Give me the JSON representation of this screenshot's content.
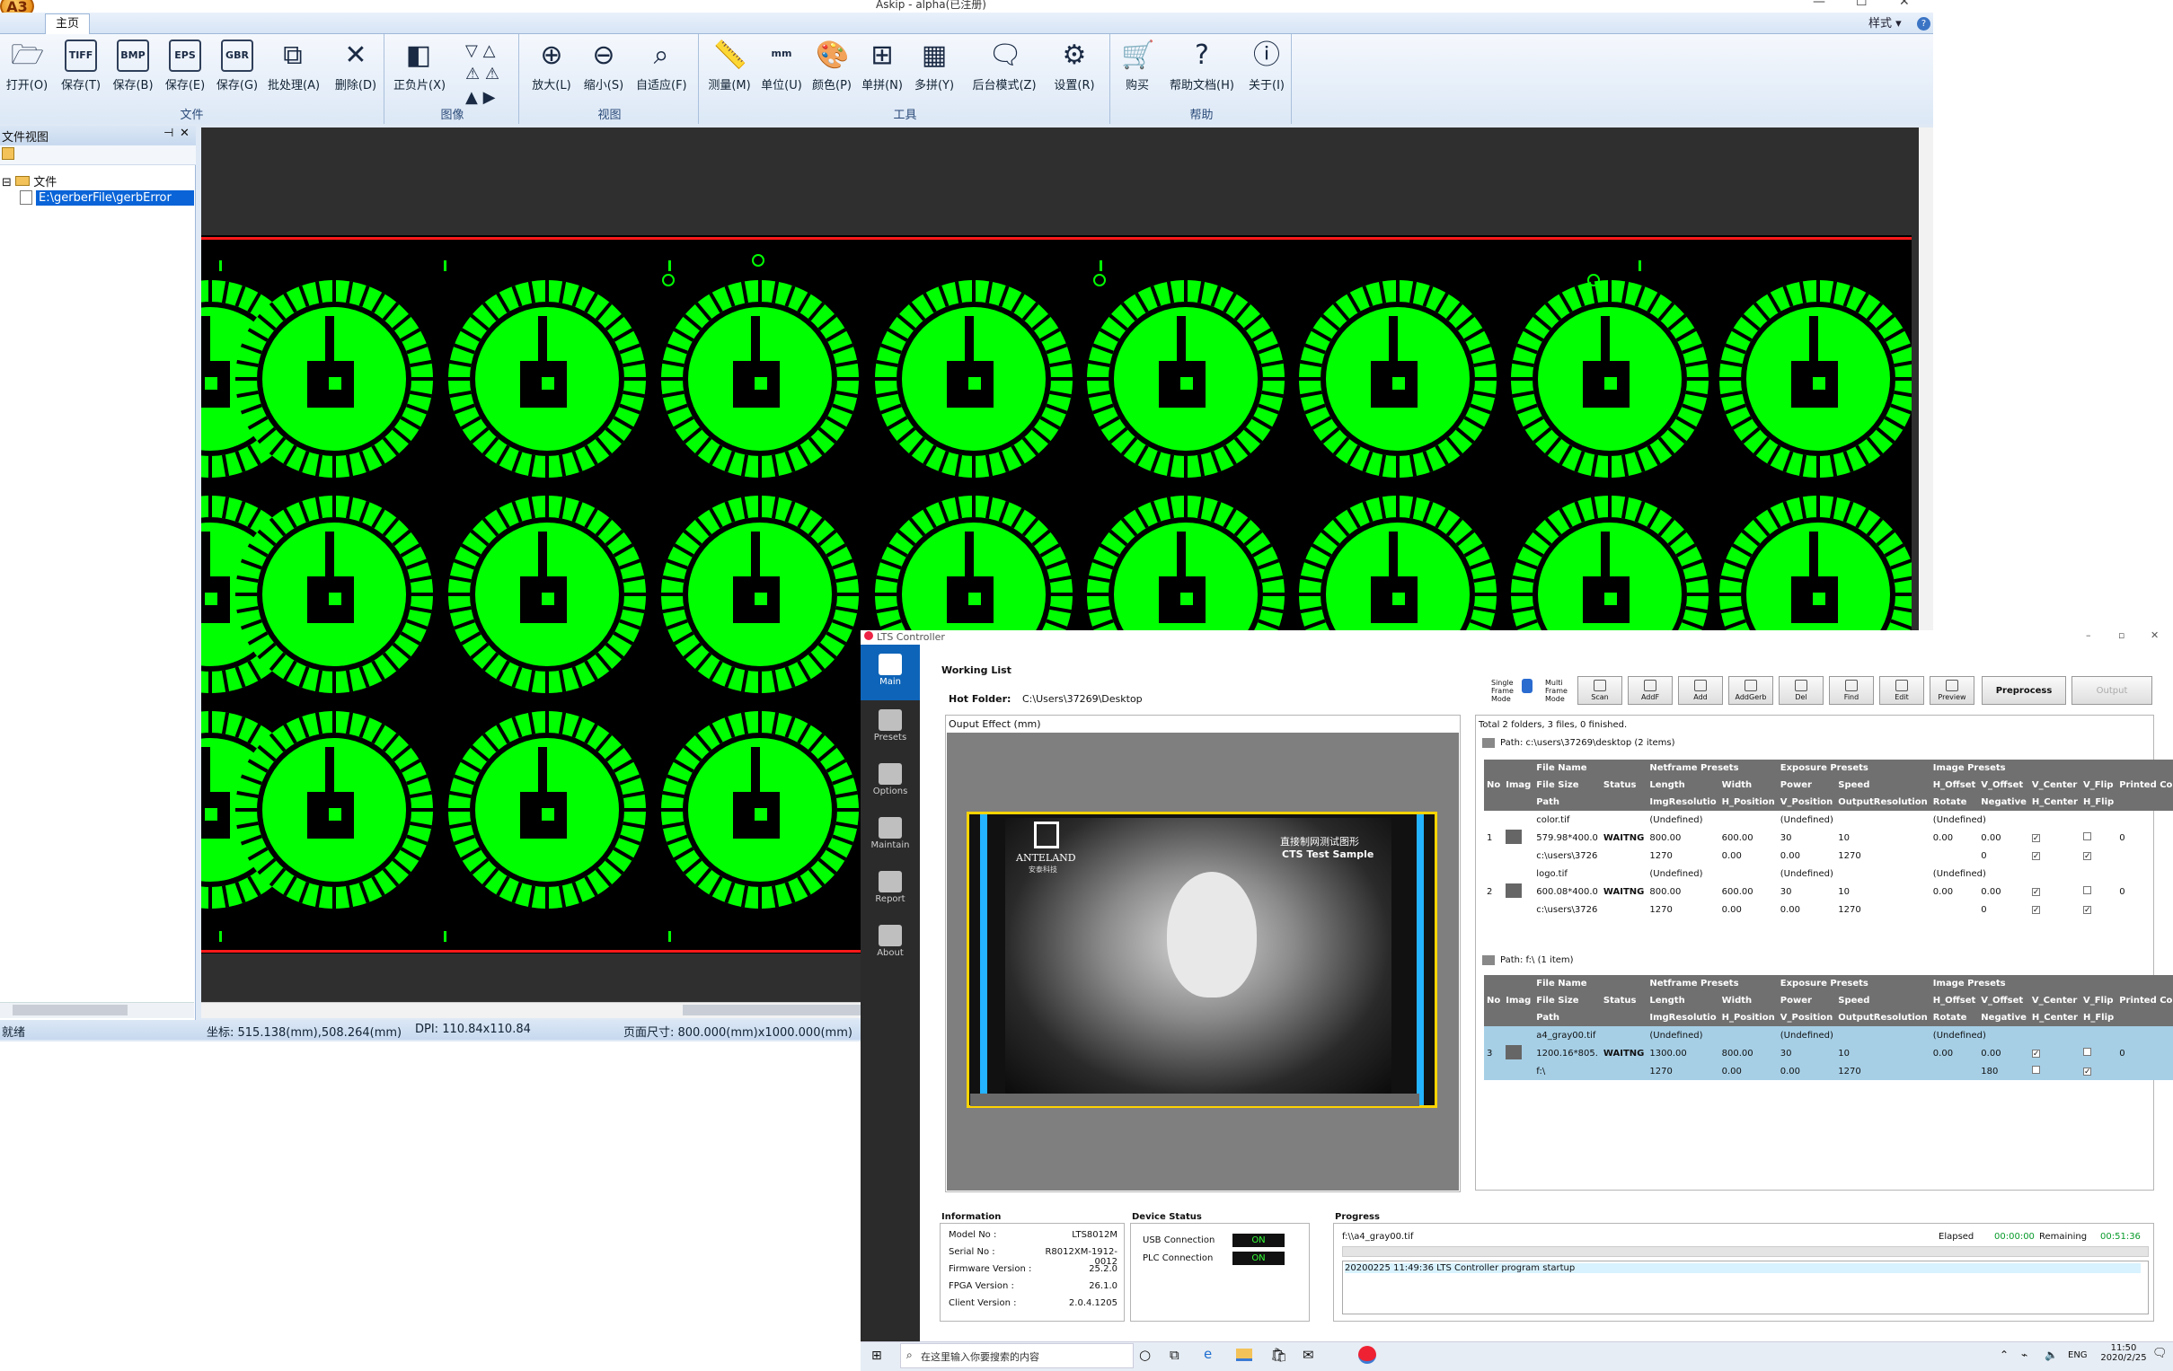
{
  "askip": {
    "window_title": "Askip - alpha(已注册)",
    "app_logo": "A3",
    "tab_home": "主页",
    "style_menu": "样式 ▾",
    "ribbon": {
      "groups": [
        {
          "label": "文件",
          "buttons": [
            {
              "label": "打开(O)",
              "icon": "folder-open-icon"
            },
            {
              "label": "保存(T)",
              "icon": "TIFF"
            },
            {
              "label": "保存(B)",
              "icon": "BMP"
            },
            {
              "label": "保存(E)",
              "icon": "EPS"
            },
            {
              "label": "保存(G)",
              "icon": "GBR"
            },
            {
              "label": "批处理(A)",
              "icon": "batch-icon"
            },
            {
              "label": "删除(D)",
              "icon": "delete-icon"
            }
          ]
        },
        {
          "label": "图像",
          "buttons": [
            {
              "label": "正负片(X)",
              "icon": "negative-icon"
            }
          ]
        },
        {
          "label": "视图",
          "buttons": [
            {
              "label": "放大(L)",
              "icon": "zoom-in-icon"
            },
            {
              "label": "缩小(S)",
              "icon": "zoom-out-icon"
            },
            {
              "label": "自适应(F)",
              "icon": "zoom-fit-icon"
            }
          ]
        },
        {
          "label": "工具",
          "buttons": [
            {
              "label": "测量(M)",
              "icon": "ruler-icon"
            },
            {
              "label": "单位(U)",
              "icon": "mm"
            },
            {
              "label": "颜色(P)",
              "icon": "palette-icon"
            },
            {
              "label": "单拼(N)",
              "icon": "grid-icon"
            },
            {
              "label": "多拼(Y)",
              "icon": "multi-grid-icon"
            },
            {
              "label": "后台模式(Z)",
              "icon": "chat-icon"
            },
            {
              "label": "设置(R)",
              "icon": "gear-icon"
            }
          ]
        },
        {
          "label": "帮助",
          "buttons": [
            {
              "label": "购买",
              "icon": "cart-icon"
            },
            {
              "label": "帮助文档(H)",
              "icon": "help-icon"
            },
            {
              "label": "关于(I)",
              "icon": "info-icon"
            }
          ]
        }
      ]
    },
    "file_view": {
      "title": "文件视图",
      "root": "文件",
      "child": "E:\\gerberFile\\gerbError"
    },
    "status": {
      "ready": "就绪",
      "coords": "坐标: 515.138(mm),508.264(mm)",
      "dpi": "DPI: 110.84x110.84",
      "page_size": "页面尺寸: 800.000(mm)x1000.000(mm)"
    },
    "colors": {
      "trace": "#00ff00",
      "frame": "#ff1a1a",
      "background": "#000000"
    }
  },
  "lts": {
    "window_title": "LTS Controller",
    "nav": [
      {
        "label": "Main",
        "icon": "home-icon"
      },
      {
        "label": "Presets",
        "icon": "presets-icon"
      },
      {
        "label": "Options",
        "icon": "options-icon"
      },
      {
        "label": "Maintain",
        "icon": "maintain-icon"
      },
      {
        "label": "Report",
        "icon": "report-icon"
      },
      {
        "label": "About",
        "icon": "about-icon"
      }
    ],
    "working_list": "Working List",
    "hot_folder_label": "Hot Folder:",
    "hot_folder_value": "C:\\Users\\37269\\Desktop",
    "single_frame": "Single Frame Mode",
    "multi_frame": "Multi Frame Mode",
    "toolbar": [
      "Scan",
      "AddF",
      "Add",
      "AddGerb",
      "Del",
      "Find",
      "Edit",
      "Preview"
    ],
    "preprocess": "Preprocess",
    "output": "Output",
    "output_effect": "Ouput Effect   (mm)",
    "preview": {
      "brand": "ANTELAND",
      "brand_cn": "安泰科技",
      "title_cn": "直接制网测试图形",
      "title_en": "CTS Test Sample"
    },
    "summary": "Total 2 folders, 3 files, 0 finished.",
    "folders": [
      {
        "path": "Path: c:\\users\\37269\\desktop (2 items)",
        "rows": [
          {
            "no": "1",
            "a": [
              "color.tif",
              "579.98*400.0",
              "c:\\users\\3726"
            ],
            "status": "WAITNG",
            "b": [
              "(Undefined)",
              "800.00",
              "600.00",
              "0.00",
              "0.00"
            ],
            "c": [
              "(Undefined)",
              "30",
              "10",
              "1270"
            ],
            "d": [
              "(Undefined)",
              "0.00",
              "0.00",
              "0"
            ],
            "printed": "0"
          },
          {
            "no": "2",
            "a": [
              "logo.tif",
              "600.08*400.0",
              "c:\\users\\3726"
            ],
            "status": "WAITNG",
            "b": [
              "(Undefined)",
              "800.00",
              "600.00",
              "0.00",
              "0.00"
            ],
            "c": [
              "(Undefined)",
              "30",
              "10",
              "1270"
            ],
            "d": [
              "(Undefined)",
              "0.00",
              "0.00",
              "0"
            ],
            "printed": "0"
          }
        ]
      },
      {
        "path": "Path: f:\\ (1 item)",
        "rows": [
          {
            "no": "3",
            "a": [
              "a4_gray00.tif",
              "1200.16*805.",
              "f:\\"
            ],
            "status": "WAITNG",
            "b": [
              "(Undefined)",
              "1300.00",
              "800.00",
              "0.00",
              "0.00"
            ],
            "c": [
              "(Undefined)",
              "30",
              "10",
              "1270"
            ],
            "d": [
              "(Undefined)",
              "0.00",
              "0.00",
              "180"
            ],
            "printed": "0"
          }
        ]
      }
    ],
    "headers": {
      "r1": [
        "No",
        "Imag",
        "File Name",
        "Status",
        "Netframe Presets",
        "",
        "Exposure Presets",
        "",
        "Image Presets",
        "",
        "",
        "",
        "Printed Co"
      ],
      "r2": [
        "File Size",
        "Length",
        "Width",
        "Power",
        "Speed",
        "H_Offset",
        "V_Offset",
        "V_Center",
        "V_Flip"
      ],
      "r3": [
        "Path",
        "ImgResolutio",
        "H_Position",
        "V_Position",
        "OutputResolution",
        "Rotate",
        "Negative",
        "H_Center",
        "H_Flip"
      ]
    },
    "info": {
      "title": "Information",
      "rows": [
        [
          "Model No :",
          "LTS8012M"
        ],
        [
          "Serial No :",
          "R8012XM-1912-0012"
        ],
        [
          "Firmware Version :",
          "25.2.0"
        ],
        [
          "FPGA Version :",
          "26.1.0"
        ],
        [
          "Client Version :",
          "2.0.4.1205"
        ]
      ]
    },
    "device": {
      "title": "Device Status",
      "usb": "USB Connection",
      "plc": "PLC Connection",
      "on": "ON"
    },
    "progress": {
      "title": "Progress",
      "file": "f:\\\\a4_gray00.tif",
      "elapsed_label": "Elapsed",
      "elapsed": "00:00:00",
      "remaining_label": "Remaining",
      "remaining": "00:51:36",
      "log": "20200225 11:49:36 LTS Controller program startup"
    }
  },
  "taskbar": {
    "search": "在这里输入你要搜索的内容",
    "lang": "ENG",
    "time": "11:50",
    "date": "2020/2/25"
  }
}
